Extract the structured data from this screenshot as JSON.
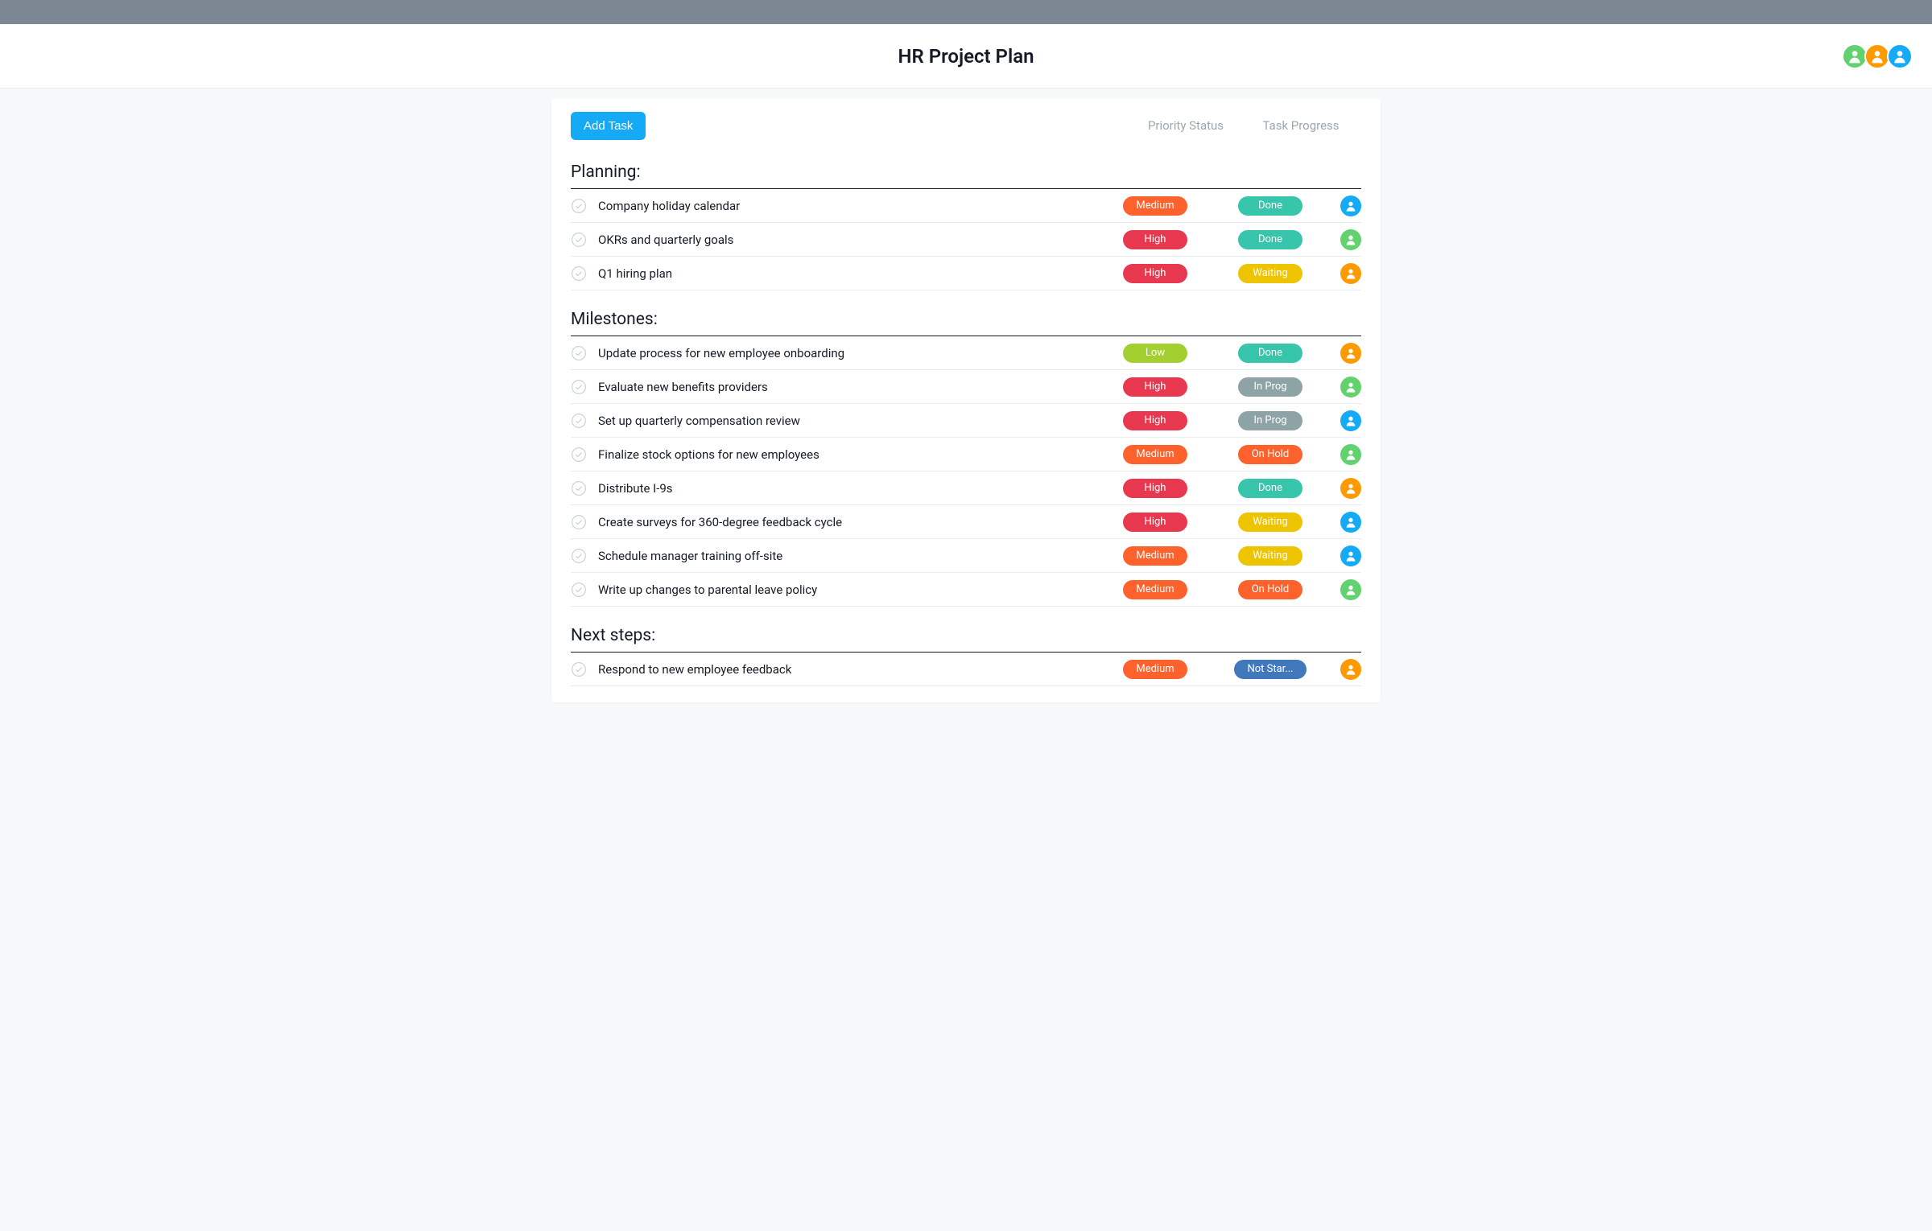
{
  "project_title": "HR Project Plan",
  "add_task_label": "Add Task",
  "columns": {
    "priority": "Priority Status",
    "progress": "Task Progress"
  },
  "header_avatars": [
    {
      "color": "green"
    },
    {
      "color": "orange"
    },
    {
      "color": "blue"
    }
  ],
  "colors": {
    "priority": {
      "High": "#e8384f",
      "Medium": "#fd612c",
      "Low": "#a4cf30"
    },
    "progress": {
      "Done": "#37c5ab",
      "Waiting": "#eec300",
      "In Prog": "#8da3a6",
      "On Hold": "#fd612c",
      "Not Star...": "#4178bc"
    },
    "avatar": {
      "green": "#62d26f",
      "orange": "#fd9a00",
      "blue": "#14aaf5"
    }
  },
  "sections": [
    {
      "title": "Planning:",
      "tasks": [
        {
          "name": "Company holiday calendar",
          "priority": "Medium",
          "progress": "Done",
          "assignee": "blue"
        },
        {
          "name": "OKRs and quarterly goals",
          "priority": "High",
          "progress": "Done",
          "assignee": "green"
        },
        {
          "name": "Q1 hiring plan",
          "priority": "High",
          "progress": "Waiting",
          "assignee": "orange"
        }
      ]
    },
    {
      "title": "Milestones:",
      "tasks": [
        {
          "name": "Update process for new employee onboarding",
          "priority": "Low",
          "progress": "Done",
          "assignee": "orange"
        },
        {
          "name": "Evaluate new benefits providers",
          "priority": "High",
          "progress": "In Prog",
          "assignee": "green"
        },
        {
          "name": "Set up quarterly compensation review",
          "priority": "High",
          "progress": "In Prog",
          "assignee": "blue"
        },
        {
          "name": "Finalize stock options for new employees",
          "priority": "Medium",
          "progress": "On Hold",
          "assignee": "green"
        },
        {
          "name": "Distribute I-9s",
          "priority": "High",
          "progress": "Done",
          "assignee": "orange"
        },
        {
          "name": "Create surveys for 360-degree feedback cycle",
          "priority": "High",
          "progress": "Waiting",
          "assignee": "blue"
        },
        {
          "name": "Schedule manager training off-site",
          "priority": "Medium",
          "progress": "Waiting",
          "assignee": "blue"
        },
        {
          "name": "Write up changes to parental leave policy",
          "priority": "Medium",
          "progress": "On Hold",
          "assignee": "green"
        }
      ]
    },
    {
      "title": "Next steps:",
      "tasks": [
        {
          "name": "Respond to new employee feedback",
          "priority": "Medium",
          "progress": "Not Star...",
          "assignee": "orange"
        }
      ]
    }
  ]
}
